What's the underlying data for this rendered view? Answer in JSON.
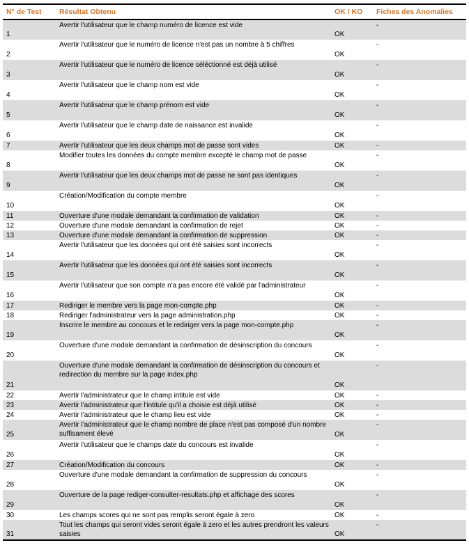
{
  "table": {
    "headers": {
      "num": "N° de Test",
      "result": "Résultat Obtenu",
      "okko": "OK / KO",
      "anomalies": "Fiches des Anomalies"
    },
    "rows": [
      {
        "num": "1",
        "result": "Avertir l'utilisateur que le champ numéro de licence est vide",
        "ok": "OK",
        "anomaly": "-"
      },
      {
        "num": "2",
        "result": "Avertir l'utilisateur que le numéro de licence n'est pas un nombre à 5 chiffres",
        "ok": "OK",
        "anomaly": "-"
      },
      {
        "num": "3",
        "result": "Avertir l'utilisateur que le numéro de licence séléctionné est déjà utilisé",
        "ok": "OK",
        "anomaly": "-"
      },
      {
        "num": "4",
        "result": "Avertir l'utilisateur que le champ nom est vide",
        "ok": "OK",
        "anomaly": "-"
      },
      {
        "num": "5",
        "result": "Avertir l'utilisateur que le champ prénom est vide",
        "ok": "OK",
        "anomaly": "-"
      },
      {
        "num": "6",
        "result": "Avertir l'utilisateur que le champ date de naissance est invalide",
        "ok": "OK",
        "anomaly": "-"
      },
      {
        "num": "7",
        "result": "Avertir l'utilisateur que les deux champs mot de passe sont vides",
        "ok": "OK",
        "anomaly": "-"
      },
      {
        "num": "8",
        "result": "Modifier toutes les données du compte membre excepté le champ mot de passe",
        "ok": "OK",
        "anomaly": "-"
      },
      {
        "num": "9",
        "result": "Avertir l'utilisateur que les deux champs mot de passe ne sont pas identiques",
        "ok": "OK",
        "anomaly": "-"
      },
      {
        "num": "10",
        "result": "Création/Modification du compte membre",
        "ok": "OK",
        "anomaly": "-"
      },
      {
        "num": "11",
        "result": "Ouverture d'une modale demandant la confirmation de validation",
        "ok": "OK",
        "anomaly": "-"
      },
      {
        "num": "12",
        "result": "Ouverture d'une modale demandant la confirmation de rejet",
        "ok": "OK",
        "anomaly": "-"
      },
      {
        "num": "13",
        "result": "Ouverture d'une modale demandant la confirmation de suppression",
        "ok": "OK",
        "anomaly": "-"
      },
      {
        "num": "14",
        "result": "Avertir l'utilisateur que les données qui ont été saisies sont incorrects",
        "ok": "OK",
        "anomaly": "-"
      },
      {
        "num": "15",
        "result": "Avertir l'utilisateur que les données qui ont été saisies sont incorrects",
        "ok": "OK",
        "anomaly": "-"
      },
      {
        "num": "16",
        "result": "Avertir l'utilisateur que son compte n'a pas encore été validé par l'administrateur",
        "ok": "OK",
        "anomaly": "-"
      },
      {
        "num": "17",
        "result": "Rediriger le membre vers la page mon-compte.php",
        "ok": "OK",
        "anomaly": "-"
      },
      {
        "num": "18",
        "result": "Rediriger l'administrateur vers la page administration.php",
        "ok": "OK",
        "anomaly": "-"
      },
      {
        "num": "19",
        "result": "Inscrire le membre au concours et le rediriger vers la page mon-compte.php",
        "ok": "OK",
        "anomaly": "-"
      },
      {
        "num": "20",
        "result": "Ouverture d'une modale demandant la confirmation de désinscription du concours",
        "ok": "OK",
        "anomaly": "-"
      },
      {
        "num": "21",
        "result": "Ouverture d'une modale demandant la confirmation de désinscription du concours et redirection du membre sur la page index.php",
        "ok": "OK",
        "anomaly": "-"
      },
      {
        "num": "22",
        "result": "Avertir l'administrateur que le champ intitule est vide",
        "ok": "OK",
        "anomaly": "-"
      },
      {
        "num": "23",
        "result": "Avertir l'administrateur que l'intitule qu'il a choisie est déjà utilisé",
        "ok": "OK",
        "anomaly": "-"
      },
      {
        "num": "24",
        "result": "Avertir l'administrateur que le champ lieu est vide",
        "ok": "OK",
        "anomaly": "-"
      },
      {
        "num": "25",
        "result": "Avertir l'administrateur que le champ nombre de place n'est pas composé d'un nombre suffisament élevé",
        "ok": "OK",
        "anomaly": "-"
      },
      {
        "num": "26",
        "result": "Avertir l'utilisateur que le champs date du concours est invalide",
        "ok": "OK",
        "anomaly": "-"
      },
      {
        "num": "27",
        "result": "Création/Modification du concours",
        "ok": "OK",
        "anomaly": "-"
      },
      {
        "num": "28",
        "result": "Ouverture d'une modale demandant la confirmation de suppression du concours",
        "ok": "OK",
        "anomaly": "-"
      },
      {
        "num": "29",
        "result": "Ouverture de la page rediger-consulter-resultats.php et affichage des scores",
        "ok": "OK",
        "anomaly": "-"
      },
      {
        "num": "30",
        "result": "Les champs scores qui ne sont pas remplis seront égale à zero",
        "ok": "OK",
        "anomaly": "-"
      },
      {
        "num": "31",
        "result": "Tout les champs qui seront vides seront égale à zero et les autres prendront les valeurs saisies",
        "ok": "OK",
        "anomaly": "-"
      }
    ]
  },
  "colors": {
    "header_text": "#e0701a",
    "stripe": "#dcdcdc"
  }
}
